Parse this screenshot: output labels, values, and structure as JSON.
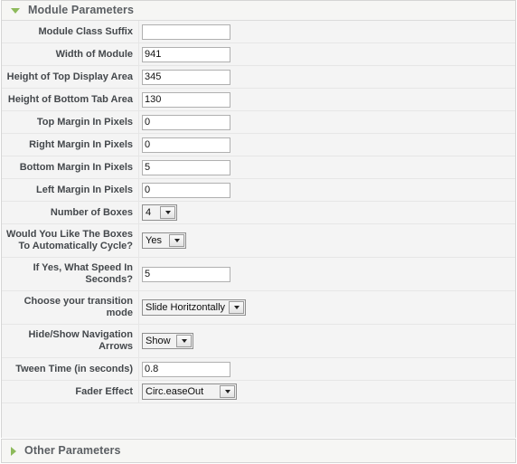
{
  "panels": {
    "module": {
      "title": "Module Parameters",
      "toggle_icon": "triangle-down-icon",
      "expanded": true
    },
    "other": {
      "title": "Other Parameters",
      "toggle_icon": "triangle-right-icon",
      "expanded": false
    }
  },
  "fields": [
    {
      "name": "module-class-suffix",
      "label": "Module Class Suffix",
      "type": "text",
      "value": "",
      "placeholder": ""
    },
    {
      "name": "width-of-module",
      "label": "Width of Module",
      "type": "text",
      "value": "941",
      "placeholder": ""
    },
    {
      "name": "height-of-top-display-area",
      "label": "Height of Top Display Area",
      "type": "text",
      "value": "345",
      "placeholder": ""
    },
    {
      "name": "height-of-bottom-tab-area",
      "label": "Height of Bottom Tab Area",
      "type": "text",
      "value": "130",
      "placeholder": ""
    },
    {
      "name": "top-margin-in-pixels",
      "label": "Top Margin In Pixels",
      "type": "text",
      "value": "0",
      "placeholder": ""
    },
    {
      "name": "right-margin-in-pixels",
      "label": "Right Margin In Pixels",
      "type": "text",
      "value": "0",
      "placeholder": ""
    },
    {
      "name": "bottom-margin-in-pixels",
      "label": "Bottom Margin In Pixels",
      "type": "text",
      "value": "5",
      "placeholder": ""
    },
    {
      "name": "left-margin-in-pixels",
      "label": "Left Margin In Pixels",
      "type": "text",
      "value": "0",
      "placeholder": ""
    },
    {
      "name": "number-of-boxes",
      "label": "Number of Boxes",
      "type": "select",
      "value": "4",
      "size_class": "sel-w-num"
    },
    {
      "name": "auto-cycle-boxes",
      "label": "Would You Like The Boxes To Automatically Cycle?",
      "type": "select",
      "value": "Yes",
      "size_class": "sel-w-yes"
    },
    {
      "name": "cycle-speed-in-seconds",
      "label": "If Yes, What Speed In Seconds?",
      "type": "text",
      "value": "5",
      "placeholder": ""
    },
    {
      "name": "transition-mode",
      "label": "Choose your transition mode",
      "type": "select",
      "value": "Slide Horitzontally",
      "size_class": "sel-w-trans"
    },
    {
      "name": "hide-show-navigation-arrows",
      "label": "Hide/Show Navigation Arrows",
      "type": "select",
      "value": "Show",
      "size_class": "sel-w-show"
    },
    {
      "name": "tween-time-in-seconds",
      "label": "Tween Time (in seconds)",
      "type": "text",
      "value": "0.8",
      "placeholder": ""
    },
    {
      "name": "fader-effect",
      "label": "Fader Effect",
      "type": "select",
      "value": "Circ.easeOut",
      "size_class": "sel-w-fader"
    }
  ],
  "colors": {
    "accent_green": "#8dba5b",
    "panel_bg": "#f4f4f4",
    "header_bg": "#f6f6f4",
    "border": "#d5d5d5",
    "row_divider": "#e6e6e6",
    "label_text": "#44484c",
    "title_text": "#5b5f63"
  }
}
